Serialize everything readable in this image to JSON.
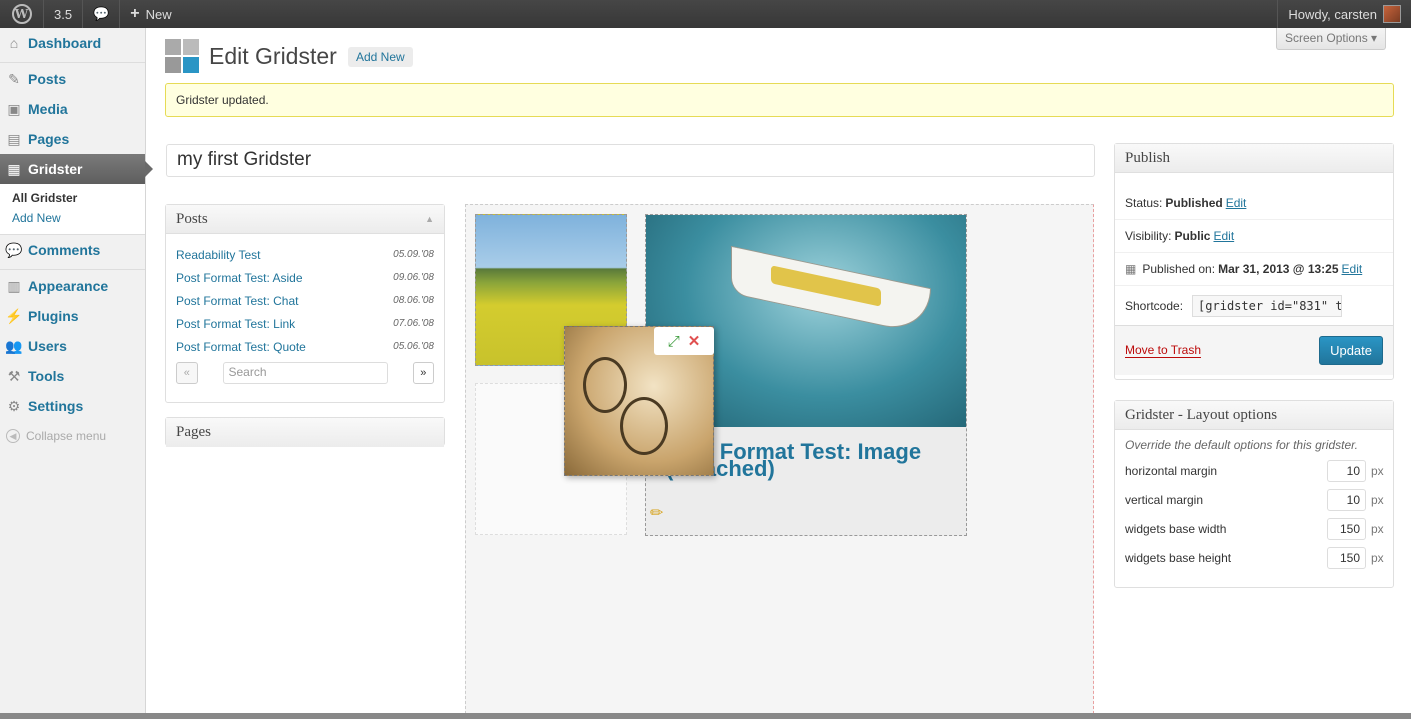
{
  "adminbar": {
    "wp_logo": "W",
    "updates": "3.5",
    "comments_icon": "speech-bubble-icon",
    "new_label": "New",
    "howdy": "Howdy, carsten"
  },
  "sidebar": {
    "items": [
      {
        "label": "Dashboard",
        "icon": "dashboard-icon"
      },
      {
        "label": "Posts",
        "icon": "pin-icon"
      },
      {
        "label": "Media",
        "icon": "media-icon"
      },
      {
        "label": "Pages",
        "icon": "pages-icon"
      },
      {
        "label": "Gridster",
        "icon": "grid-icon"
      },
      {
        "label": "Comments",
        "icon": "comment-icon"
      },
      {
        "label": "Appearance",
        "icon": "appearance-icon"
      },
      {
        "label": "Plugins",
        "icon": "plug-icon"
      },
      {
        "label": "Users",
        "icon": "users-icon"
      },
      {
        "label": "Tools",
        "icon": "tools-icon"
      },
      {
        "label": "Settings",
        "icon": "settings-icon"
      }
    ],
    "submenu": [
      "All Gridster",
      "Add New"
    ],
    "collapse": "Collapse menu"
  },
  "header": {
    "title": "Edit Gridster",
    "add_new": "Add New",
    "screen_options": "Screen Options ▾"
  },
  "notice": "Gridster updated.",
  "post_title": "my first Gridster",
  "posts_box": {
    "title": "Posts",
    "rows": [
      {
        "title": "Readability Test",
        "date": "05.09.'08"
      },
      {
        "title": "Post Format Test: Aside",
        "date": "09.06.'08"
      },
      {
        "title": "Post Format Test: Chat",
        "date": "08.06.'08"
      },
      {
        "title": "Post Format Test: Link",
        "date": "07.06.'08"
      },
      {
        "title": "Post Format Test: Quote",
        "date": "05.06.'08"
      }
    ],
    "prev": "«",
    "next": "»",
    "search_placeholder": "Search"
  },
  "pages_box": {
    "title": "Pages"
  },
  "grid": {
    "boat_caption": "Post Format Test: Image (Attached)"
  },
  "publish": {
    "title": "Publish",
    "status_label": "Status:",
    "status_value": "Published",
    "edit": "Edit",
    "visibility_label": "Visibility:",
    "visibility_value": "Public",
    "published_label": "Published on:",
    "published_value": "Mar 31, 2013 @ 13:25",
    "shortcode_label": "Shortcode:",
    "shortcode_value": "[gridster id=\"831\" t",
    "trash": "Move to Trash",
    "update": "Update"
  },
  "layout_options": {
    "title": "Gridster - Layout options",
    "desc": "Override the default options for this gridster.",
    "unit": "px",
    "rows": [
      {
        "label": "horizontal margin",
        "value": "10"
      },
      {
        "label": "vertical margin",
        "value": "10"
      },
      {
        "label": "widgets base width",
        "value": "150"
      },
      {
        "label": "widgets base height",
        "value": "150"
      }
    ]
  }
}
